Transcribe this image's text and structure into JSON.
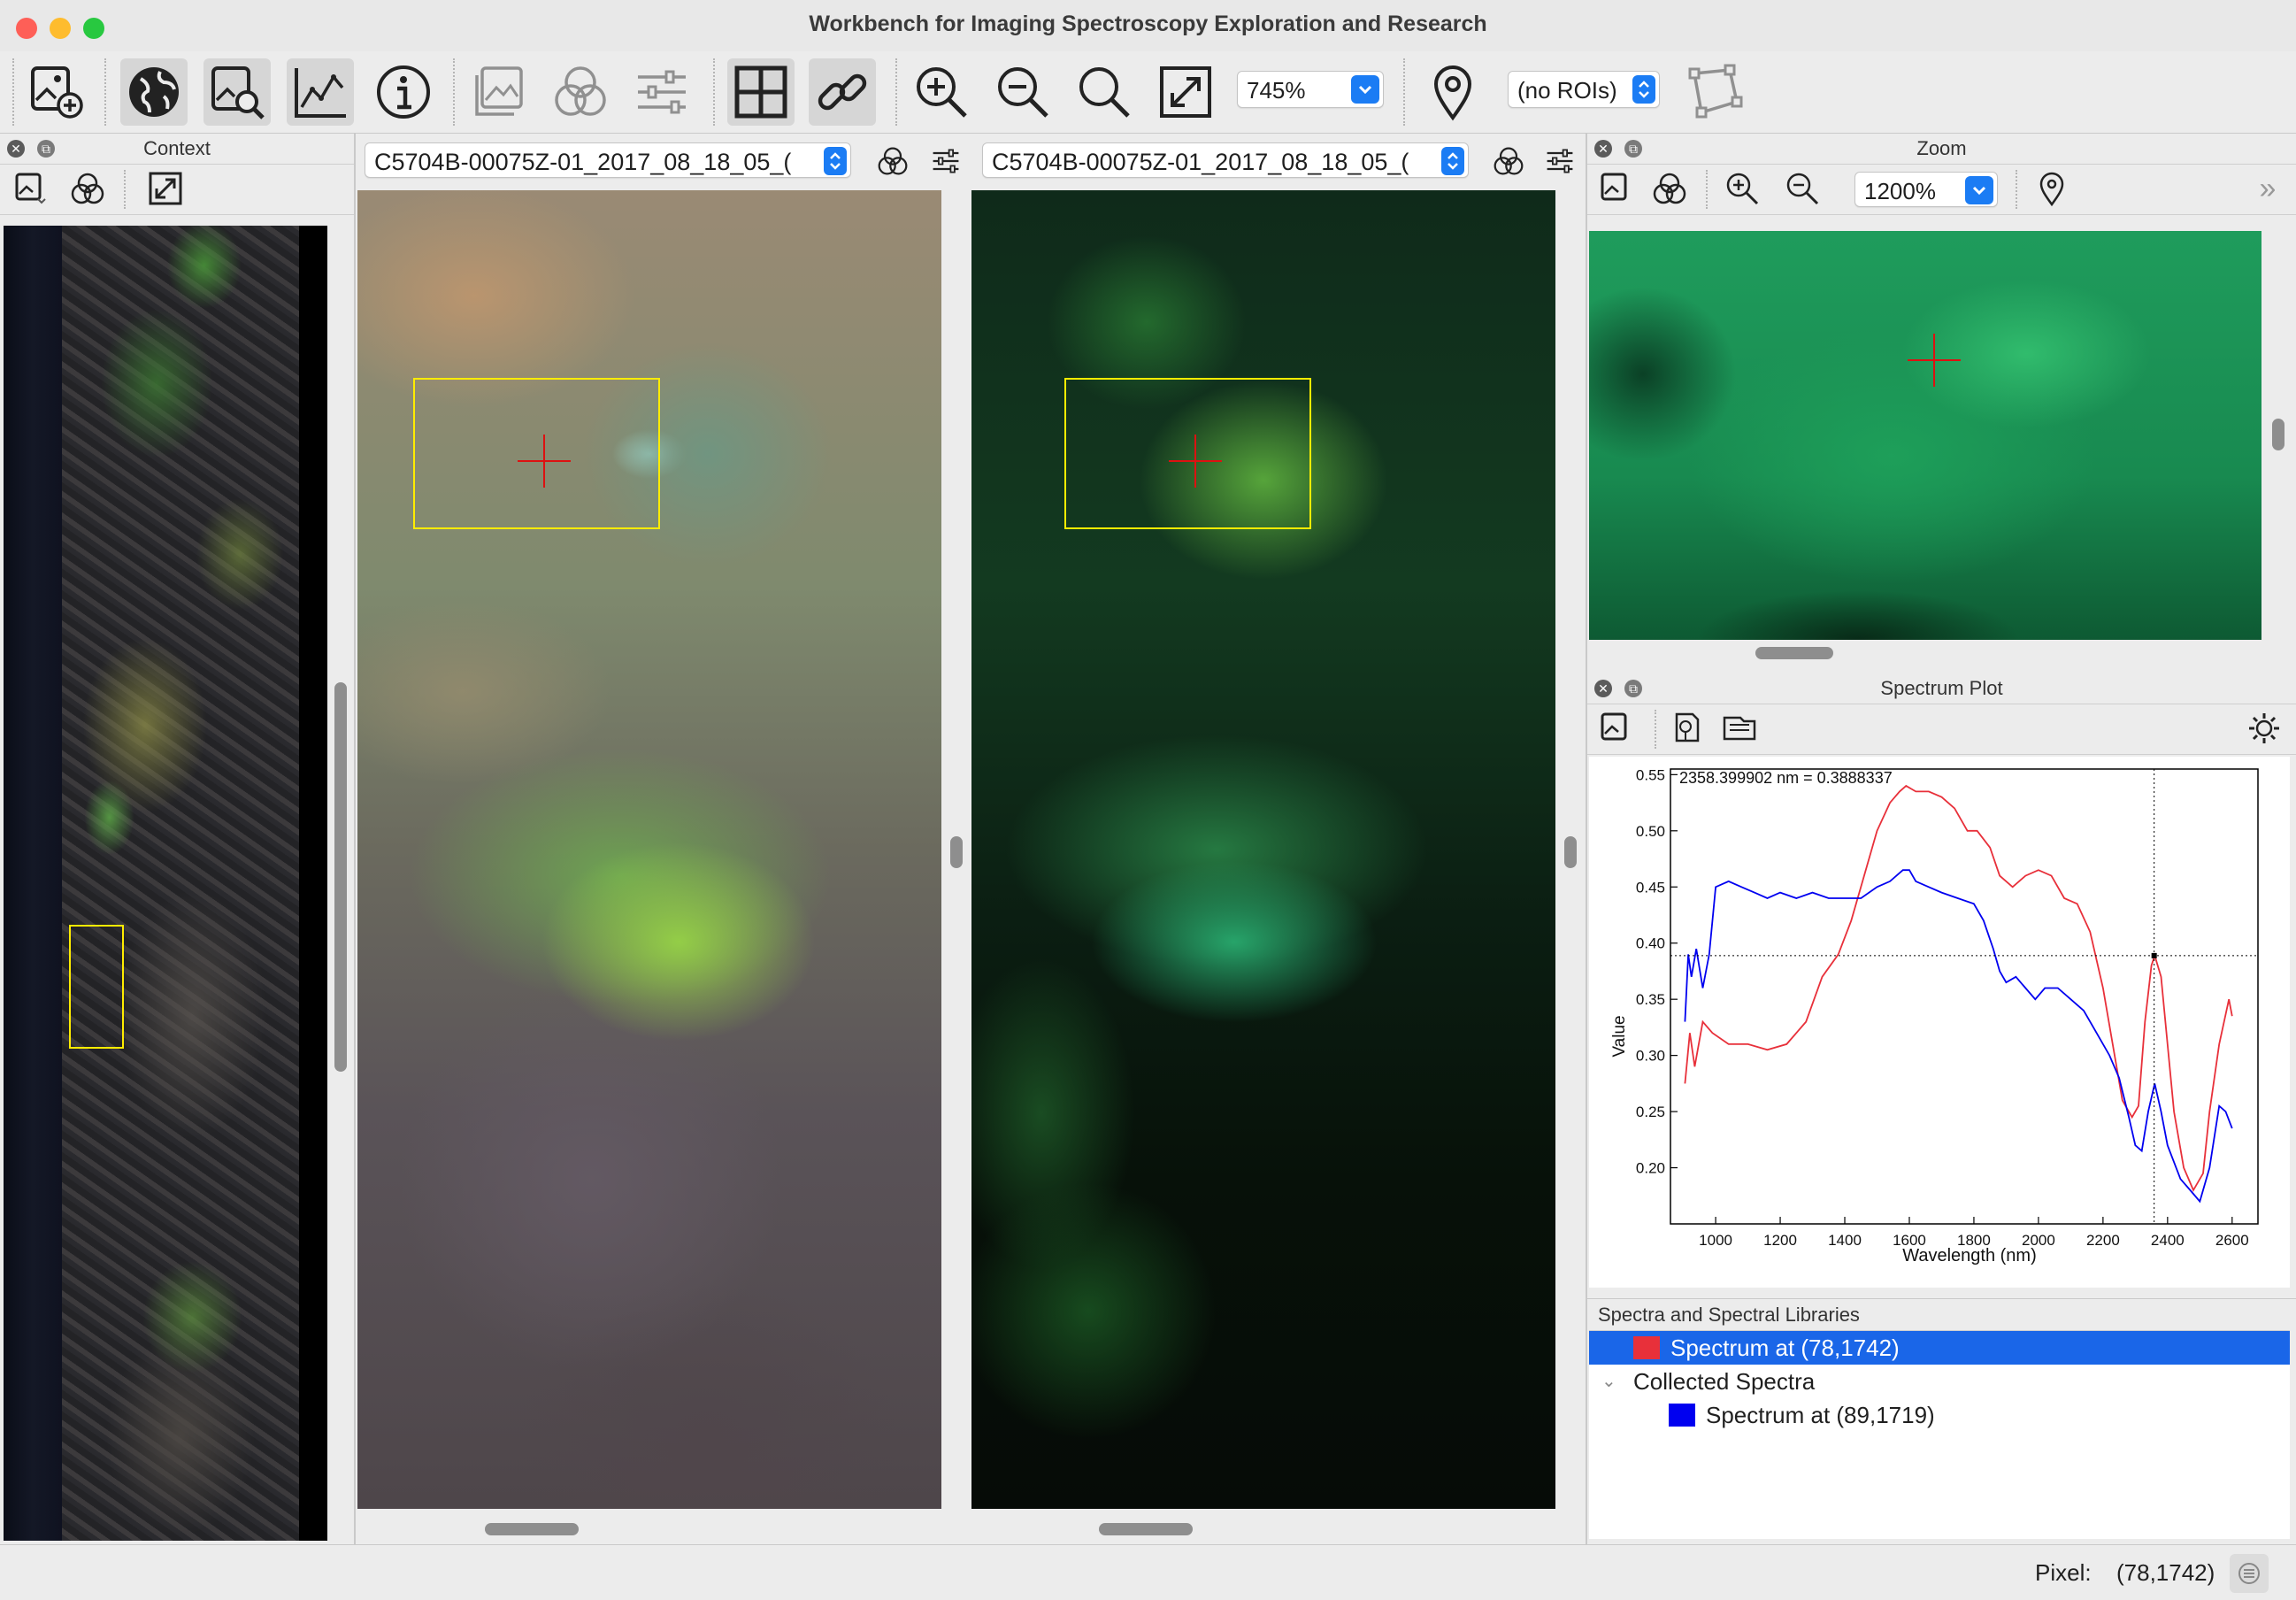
{
  "window": {
    "title": "Workbench for Imaging Spectroscopy Exploration and Research"
  },
  "toolbar": {
    "buttons": [
      "open-image",
      "geographic-view",
      "image-info-view",
      "spectrum-plot",
      "info",
      "image-bands",
      "rgb-channels",
      "stretch-settings",
      "grid-layout",
      "link-views",
      "zoom-in",
      "zoom-out",
      "zoom-fit",
      "zoom-full"
    ],
    "zoom_value": "745%",
    "roi_value": "(no ROIs)"
  },
  "context_panel": {
    "title": "Context"
  },
  "main_views": {
    "left": {
      "dataset": "C5704B-00075Z-01_2017_08_18_05_("
    },
    "right": {
      "dataset": "C5704B-00075Z-01_2017_08_18_05_("
    }
  },
  "zoom_panel": {
    "title": "Zoom",
    "zoom_value": "1200%"
  },
  "spectrum_panel": {
    "title": "Spectrum Plot",
    "list_header": "Spectra and Spectral Libraries",
    "active_spectrum": "Spectrum at (78,1742)",
    "collected_group": "Collected Spectra",
    "collected_items": [
      "Spectrum at (89,1719)"
    ],
    "colors": {
      "active": "#e8303a",
      "collected": "#0000f0",
      "selection": "#1a66e8"
    }
  },
  "status": {
    "pixel_label": "Pixel:",
    "pixel_value": "(78,1742)"
  },
  "chart_data": {
    "type": "line",
    "xlabel": "Wavelength (nm)",
    "ylabel": "Value",
    "xlim": [
      860,
      2680
    ],
    "ylim": [
      0.15,
      0.555
    ],
    "x_ticks": [
      1000,
      1200,
      1400,
      1600,
      1800,
      2000,
      2200,
      2400,
      2600
    ],
    "y_ticks": [
      0.2,
      0.25,
      0.3,
      0.35,
      0.4,
      0.45,
      0.5,
      0.55
    ],
    "annotation": "2358.399902 nm = 0.3888337",
    "cursor": {
      "x": 2358.399902,
      "y": 0.3888337
    },
    "series": [
      {
        "color": "#e8303a",
        "x": [
          905,
          920,
          935,
          960,
          990,
          1040,
          1100,
          1160,
          1220,
          1280,
          1330,
          1380,
          1420,
          1460,
          1500,
          1540,
          1570,
          1590,
          1620,
          1660,
          1700,
          1740,
          1780,
          1810,
          1850,
          1880,
          1920,
          1960,
          2000,
          2040,
          2080,
          2120,
          2160,
          2200,
          2230,
          2260,
          2290,
          2310,
          2330,
          2350,
          2360,
          2380,
          2400,
          2420,
          2450,
          2480,
          2510,
          2530,
          2560,
          2590,
          2600
        ],
        "y": [
          0.275,
          0.32,
          0.29,
          0.33,
          0.32,
          0.31,
          0.31,
          0.305,
          0.31,
          0.33,
          0.37,
          0.39,
          0.42,
          0.46,
          0.5,
          0.525,
          0.535,
          0.54,
          0.535,
          0.535,
          0.53,
          0.52,
          0.5,
          0.5,
          0.485,
          0.46,
          0.45,
          0.46,
          0.465,
          0.46,
          0.44,
          0.435,
          0.41,
          0.36,
          0.31,
          0.26,
          0.245,
          0.255,
          0.33,
          0.38,
          0.389,
          0.37,
          0.31,
          0.25,
          0.2,
          0.18,
          0.195,
          0.25,
          0.31,
          0.35,
          0.335
        ]
      },
      {
        "color": "#0000f0",
        "x": [
          905,
          915,
          925,
          940,
          960,
          980,
          1000,
          1040,
          1080,
          1120,
          1160,
          1200,
          1250,
          1300,
          1350,
          1400,
          1450,
          1500,
          1540,
          1580,
          1600,
          1620,
          1660,
          1700,
          1750,
          1800,
          1830,
          1860,
          1880,
          1900,
          1930,
          1960,
          1990,
          2020,
          2060,
          2100,
          2140,
          2180,
          2220,
          2250,
          2280,
          2300,
          2320,
          2340,
          2360,
          2380,
          2400,
          2440,
          2470,
          2500,
          2530,
          2560,
          2580,
          2600
        ],
        "y": [
          0.33,
          0.39,
          0.37,
          0.395,
          0.36,
          0.39,
          0.45,
          0.455,
          0.45,
          0.445,
          0.44,
          0.445,
          0.44,
          0.445,
          0.44,
          0.44,
          0.44,
          0.45,
          0.455,
          0.465,
          0.465,
          0.455,
          0.45,
          0.445,
          0.44,
          0.435,
          0.42,
          0.395,
          0.375,
          0.365,
          0.37,
          0.36,
          0.35,
          0.36,
          0.36,
          0.35,
          0.34,
          0.32,
          0.3,
          0.28,
          0.245,
          0.22,
          0.215,
          0.25,
          0.275,
          0.25,
          0.22,
          0.19,
          0.18,
          0.17,
          0.2,
          0.255,
          0.25,
          0.235
        ]
      }
    ]
  }
}
